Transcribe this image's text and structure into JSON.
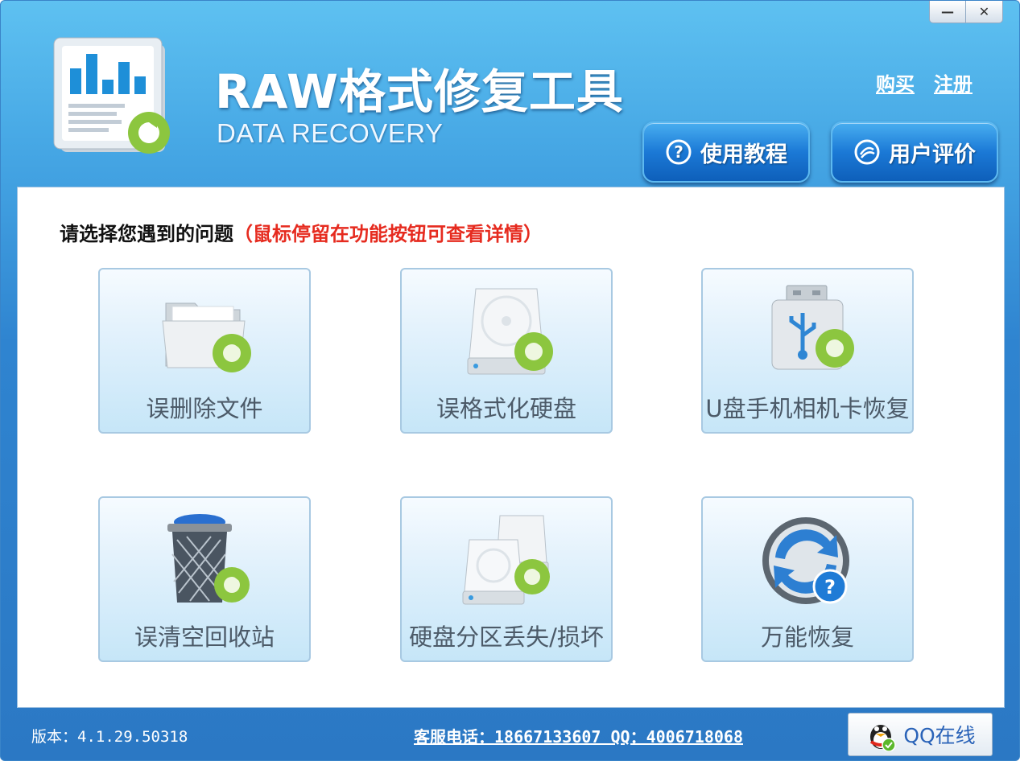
{
  "window": {
    "minimize_symbol": "—",
    "close_symbol": "✕"
  },
  "header": {
    "title": "RAW格式修复工具",
    "subtitle": "DATA RECOVERY",
    "links": {
      "buy": "购买",
      "register": "注册"
    },
    "buttons": {
      "tutorial": "使用教程",
      "reviews": "用户评价"
    }
  },
  "main": {
    "prompt": "请选择您遇到的问题",
    "hint": "（鼠标停留在功能按钮可查看详情）",
    "tiles": [
      {
        "label": "误删除文件",
        "icon": "folder-recover-icon"
      },
      {
        "label": "误格式化硬盘",
        "icon": "hard-drive-recover-icon"
      },
      {
        "label": "U盘手机相机卡恢复",
        "icon": "usb-drive-recover-icon"
      },
      {
        "label": "误清空回收站",
        "icon": "recycle-bin-recover-icon"
      },
      {
        "label": "硬盘分区丢失/损坏",
        "icon": "partition-recover-icon"
      },
      {
        "label": "万能恢复",
        "icon": "universal-recover-icon"
      }
    ]
  },
  "footer": {
    "version": "版本：4.1.29.50318",
    "contact": "客服电话：18667133607 QQ：4006718068",
    "qq_button": "QQ在线"
  },
  "colors": {
    "accent": "#2b78c4",
    "hint_red": "#e62b1f",
    "recover_green": "#8cc63f"
  }
}
